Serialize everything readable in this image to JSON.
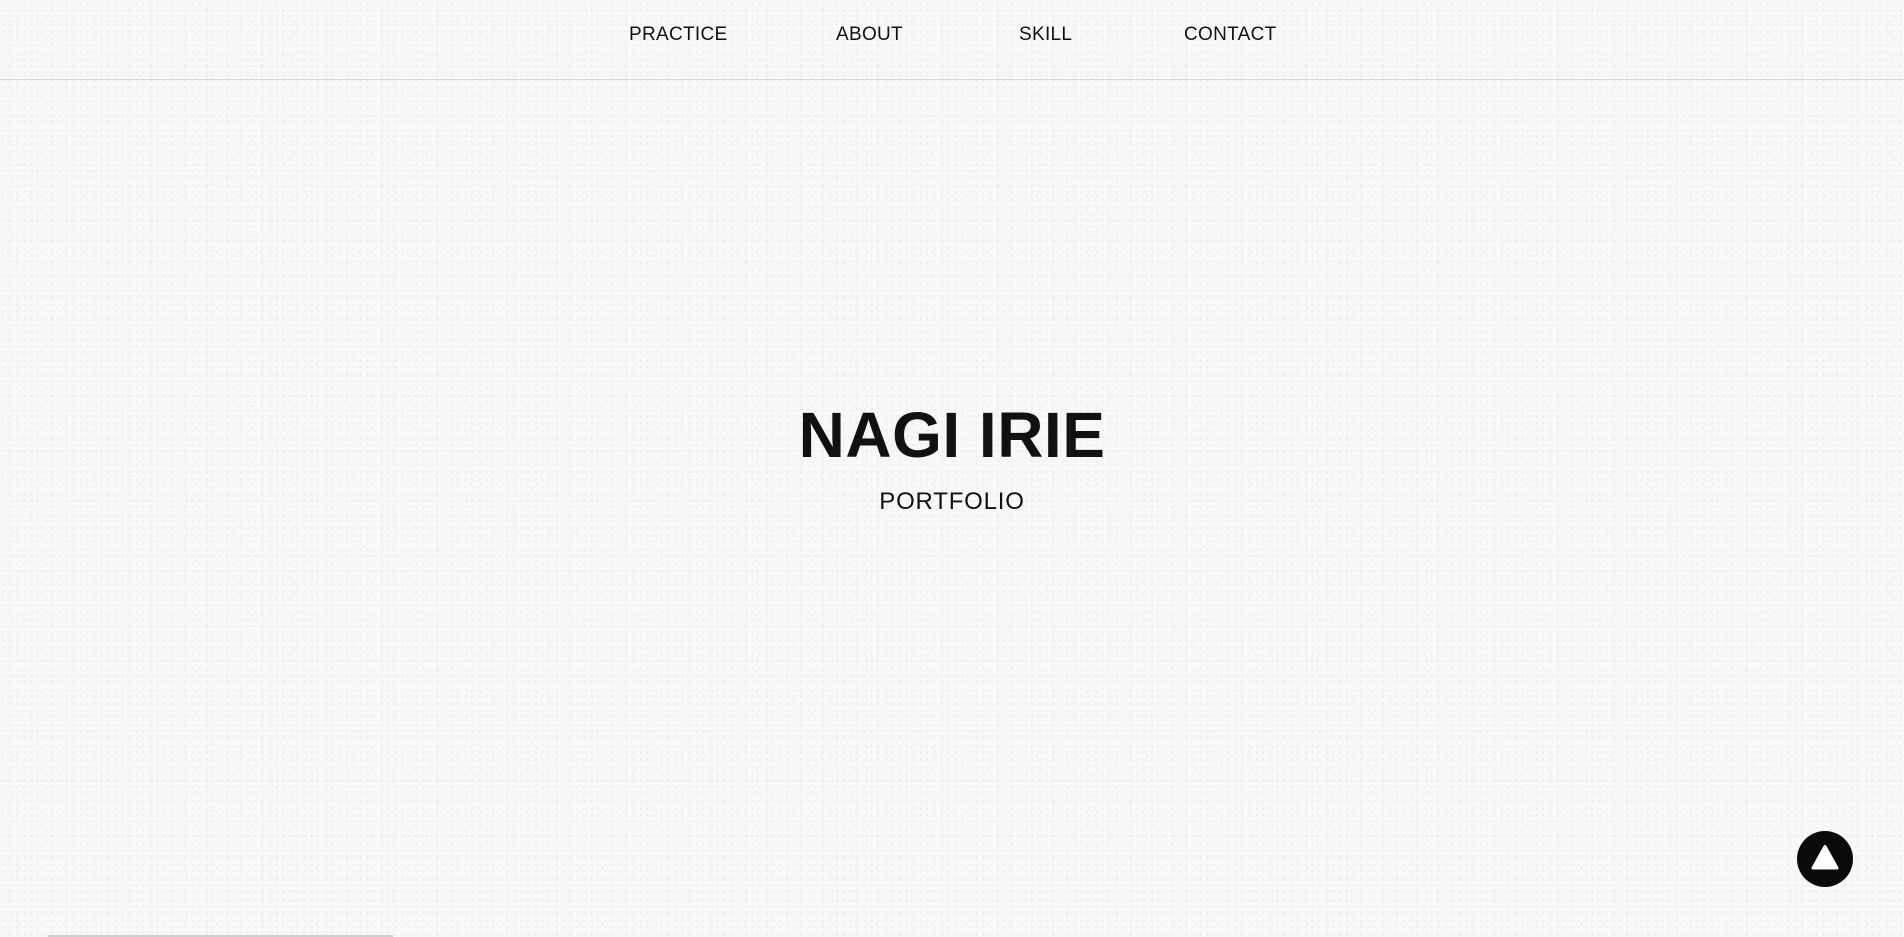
{
  "nav": {
    "items": [
      {
        "label": "PRACTICE"
      },
      {
        "label": "ABOUT"
      },
      {
        "label": "SKILL"
      },
      {
        "label": "CONTACT"
      }
    ]
  },
  "hero": {
    "title": "NAGI IRIE",
    "subtitle": "PORTFOLIO"
  },
  "back_to_top": {
    "icon": "triangle-up-icon",
    "color": "#0a0a0a"
  }
}
